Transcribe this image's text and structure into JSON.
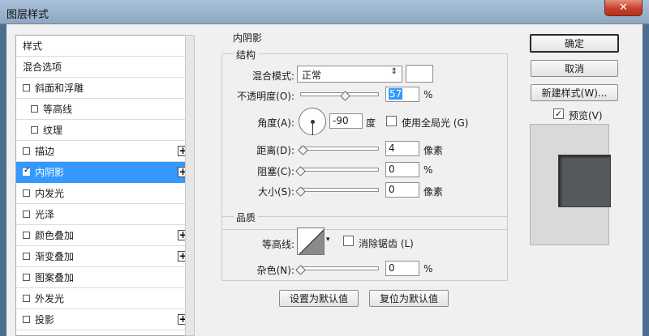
{
  "window": {
    "title": "图层样式",
    "close_label": "✕"
  },
  "style_list": {
    "items": [
      {
        "label": "样式",
        "checkbox": false,
        "checked": false,
        "plus": false,
        "indent": false,
        "selected": false
      },
      {
        "label": "混合选项",
        "checkbox": false,
        "checked": false,
        "plus": false,
        "indent": false,
        "selected": false
      },
      {
        "label": "斜面和浮雕",
        "checkbox": true,
        "checked": false,
        "plus": false,
        "indent": false,
        "selected": false
      },
      {
        "label": "等高线",
        "checkbox": true,
        "checked": false,
        "plus": false,
        "indent": true,
        "selected": false
      },
      {
        "label": "纹理",
        "checkbox": true,
        "checked": false,
        "plus": false,
        "indent": true,
        "selected": false
      },
      {
        "label": "描边",
        "checkbox": true,
        "checked": false,
        "plus": true,
        "indent": false,
        "selected": false
      },
      {
        "label": "内阴影",
        "checkbox": true,
        "checked": true,
        "plus": true,
        "indent": false,
        "selected": true
      },
      {
        "label": "内发光",
        "checkbox": true,
        "checked": false,
        "plus": false,
        "indent": false,
        "selected": false
      },
      {
        "label": "光泽",
        "checkbox": true,
        "checked": false,
        "plus": false,
        "indent": false,
        "selected": false
      },
      {
        "label": "颜色叠加",
        "checkbox": true,
        "checked": false,
        "plus": true,
        "indent": false,
        "selected": false
      },
      {
        "label": "渐变叠加",
        "checkbox": true,
        "checked": false,
        "plus": true,
        "indent": false,
        "selected": false
      },
      {
        "label": "图案叠加",
        "checkbox": true,
        "checked": false,
        "plus": false,
        "indent": false,
        "selected": false
      },
      {
        "label": "外发光",
        "checkbox": true,
        "checked": false,
        "plus": false,
        "indent": false,
        "selected": false
      },
      {
        "label": "投影",
        "checkbox": true,
        "checked": false,
        "plus": true,
        "indent": false,
        "selected": false
      }
    ],
    "plus_label": "+",
    "check_label": "✓"
  },
  "inner_shadow": {
    "section_title": "内阴影",
    "structure": {
      "title": "结构",
      "blend_mode_label": "混合模式:",
      "blend_mode_value": "正常",
      "blend_mode_arrow": "⇕",
      "opacity_label": "不透明度(O):",
      "opacity_value": "57",
      "opacity_fraction": 0.57,
      "opacity_unit": "%",
      "angle_label": "角度(A):",
      "angle_value": "-90",
      "angle_unit": "度",
      "global_light_label": "使用全局光 (G)",
      "global_light_checked": false,
      "distance_label": "距离(D):",
      "distance_value": "4",
      "distance_unit": "像素",
      "choke_label": "阻塞(C):",
      "choke_value": "0",
      "choke_unit": "%",
      "size_label": "大小(S):",
      "size_value": "0",
      "size_unit": "像素"
    },
    "quality": {
      "title": "品质",
      "contour_label": "等高线:",
      "anti_alias_label": "消除锯齿 (L)",
      "anti_alias_checked": false,
      "noise_label": "杂色(N):",
      "noise_value": "0",
      "noise_unit": "%"
    },
    "make_default_label": "设置为默认值",
    "reset_default_label": "复位为默认值"
  },
  "actions": {
    "ok_label": "确定",
    "cancel_label": "取消",
    "new_style_label": "新建样式(W)...",
    "preview_label": "预览(V)",
    "preview_checked": true,
    "preview_swatch_color": "#56595d"
  },
  "colors": {
    "selected": "#3399ff",
    "dialog_bg": "#f0f0f0",
    "title_bar": "#98b1c9",
    "close_button": "#c4412a"
  }
}
